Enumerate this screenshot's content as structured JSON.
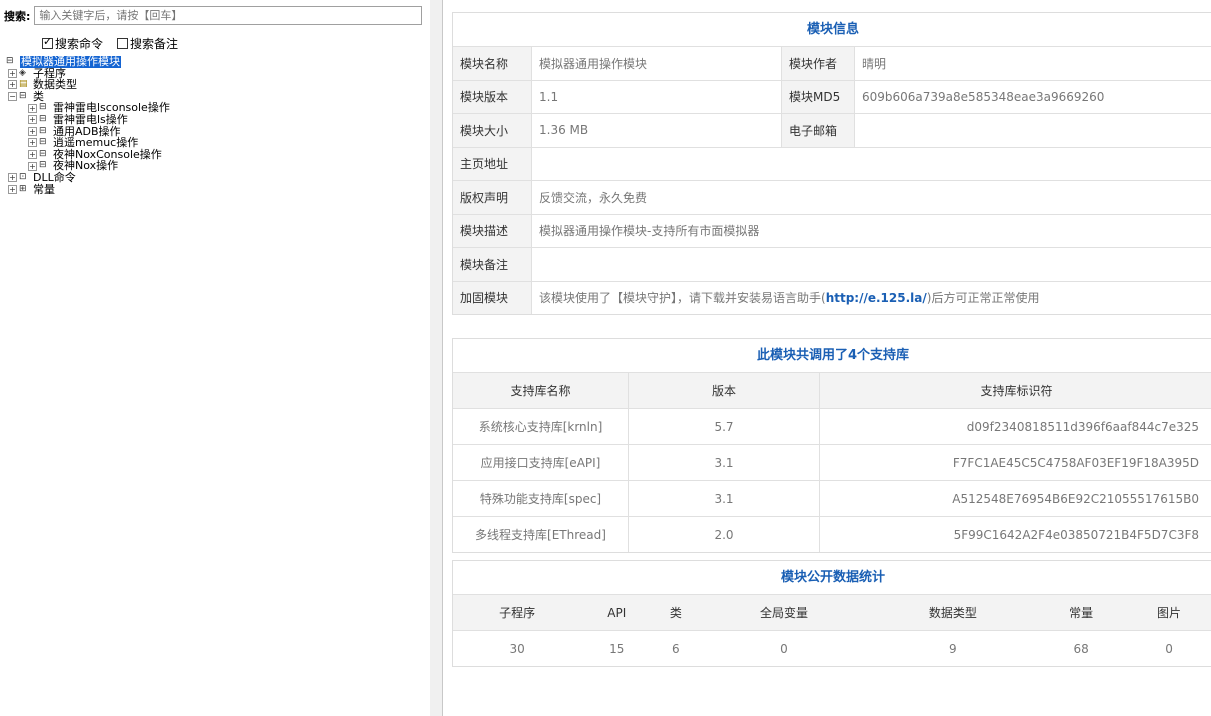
{
  "search": {
    "label": "搜索:",
    "placeholder": "输入关键字后，请按【回车】"
  },
  "checks": [
    {
      "label": "搜索命令",
      "checked": true
    },
    {
      "label": "搜索备注",
      "checked": false
    }
  ],
  "tree": [
    {
      "label": "模拟器通用操作模块",
      "icon": "module-icon",
      "exp": "",
      "indent": 0,
      "selected": true
    },
    {
      "label": "子程序",
      "icon": "subprogram-icon",
      "exp": "+",
      "indent": 1
    },
    {
      "label": "数据类型",
      "icon": "datatype-icon",
      "exp": "+",
      "indent": 1
    },
    {
      "label": "类",
      "icon": "class-icon",
      "exp": "-",
      "indent": 1
    },
    {
      "label": "雷神雷电lsconsole操作",
      "icon": "class-icon",
      "exp": "+",
      "indent": 2
    },
    {
      "label": "雷神雷电ls操作",
      "icon": "class-icon",
      "exp": "+",
      "indent": 2
    },
    {
      "label": "通用ADB操作",
      "icon": "class-icon",
      "exp": "+",
      "indent": 2
    },
    {
      "label": "逍遥memuc操作",
      "icon": "class-icon",
      "exp": "+",
      "indent": 2
    },
    {
      "label": "夜神NoxConsole操作",
      "icon": "class-icon",
      "exp": "+",
      "indent": 2
    },
    {
      "label": "夜神Nox操作",
      "icon": "class-icon",
      "exp": "+",
      "indent": 2
    },
    {
      "label": "DLL命令",
      "icon": "dll-icon",
      "exp": "+",
      "indent": 1
    },
    {
      "label": "常量",
      "icon": "constant-icon",
      "exp": "+",
      "indent": 1
    }
  ],
  "info": {
    "title": "模块信息",
    "name_label": "模块名称",
    "name": "模拟器通用操作模块",
    "author_label": "模块作者",
    "author": "晴明",
    "version_label": "模块版本",
    "version": "1.1",
    "md5_label": "模块MD5",
    "md5": "609b606a739a8e585348eae3a9669260",
    "size_label": "模块大小",
    "size": "1.36 MB",
    "email_label": "电子邮箱",
    "email": "",
    "homepage_label": "主页地址",
    "homepage": "",
    "copyright_label": "版权声明",
    "copyright": "反馈交流，永久免费",
    "desc_label": "模块描述",
    "desc": "模拟器通用操作模块-支持所有市面模拟器",
    "remark_label": "模块备注",
    "remark": "",
    "protect_label": "加固模块",
    "protect_pre": "该模块使用了【模块守护】，请下载并安装易语言助手(",
    "protect_link": "http://e.125.la/",
    "protect_post": ")后方可正常正常使用"
  },
  "libs": {
    "title": "此模块共调用了4个支持库",
    "headers": [
      "支持库名称",
      "版本",
      "支持库标识符"
    ],
    "rows": [
      [
        "系统核心支持库[krnln]",
        "5.7",
        "d09f2340818511d396f6aaf844c7e325"
      ],
      [
        "应用接口支持库[eAPI]",
        "3.1",
        "F7FC1AE45C5C4758AF03EF19F18A395D"
      ],
      [
        "特殊功能支持库[spec]",
        "3.1",
        "A512548E76954B6E92C21055517615B0"
      ],
      [
        "多线程支持库[EThread]",
        "2.0",
        "5F99C1642A2F4e03850721B4F5D7C3F8"
      ]
    ]
  },
  "stats": {
    "title": "模块公开数据统计",
    "headers": [
      "子程序",
      "API",
      "类",
      "全局变量",
      "数据类型",
      "常量",
      "图片"
    ],
    "values": [
      "30",
      "15",
      "6",
      "0",
      "9",
      "68",
      "0"
    ]
  }
}
